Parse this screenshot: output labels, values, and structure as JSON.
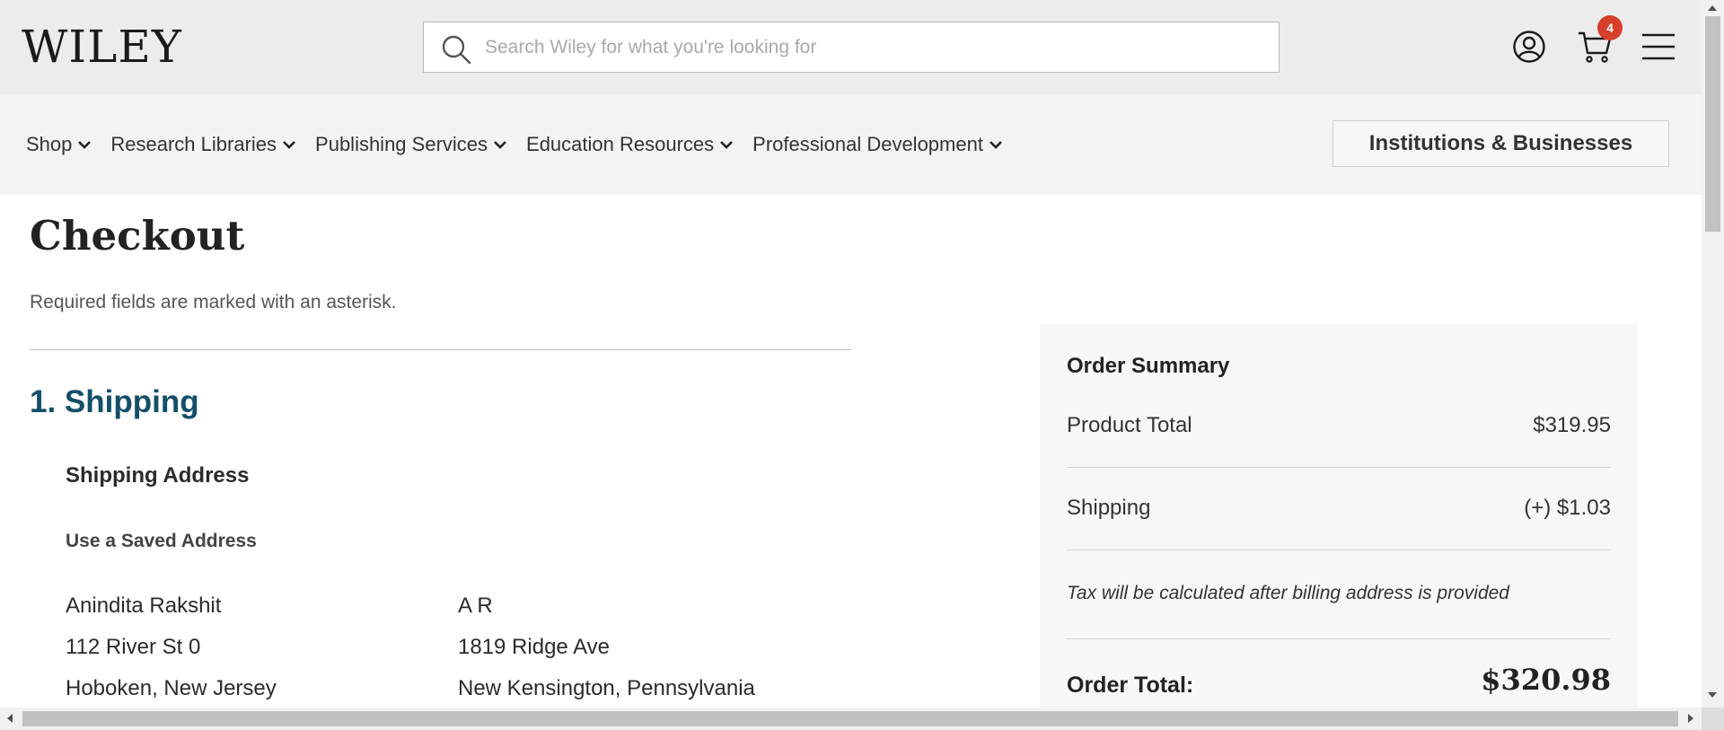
{
  "header": {
    "logo": "WILEY",
    "search_placeholder": "Search Wiley for what you're looking for",
    "cart_count": "4",
    "icons": [
      "search-icon",
      "account-icon",
      "cart-icon",
      "menu-icon"
    ]
  },
  "nav": {
    "items": [
      {
        "label": "Shop"
      },
      {
        "label": "Research Libraries"
      },
      {
        "label": "Publishing Services"
      },
      {
        "label": "Education Resources"
      },
      {
        "label": "Professional Development"
      }
    ],
    "institutions_button": "Institutions & Businesses"
  },
  "checkout": {
    "title": "Checkout",
    "required_note": "Required fields are marked with an asterisk.",
    "shipping_heading": "1. Shipping",
    "shipping_address_heading": "Shipping Address",
    "saved_address_link": "Use a Saved Address",
    "addresses": [
      {
        "name": "Anindita Rakshit",
        "street": "112 River St 0",
        "city": "Hoboken, New Jersey"
      },
      {
        "name": "A R",
        "street": "1819 Ridge Ave",
        "city": "New Kensington, Pennsylvania"
      }
    ]
  },
  "summary": {
    "title": "Order Summary",
    "product_total_label": "Product Total",
    "product_total_value": "$319.95",
    "shipping_label": "Shipping",
    "shipping_value": "(+) $1.03",
    "tax_note": "Tax will be calculated after billing address is provided",
    "order_total_label": "Order Total:",
    "order_total_value": "$320.98"
  },
  "colors": {
    "header_bg": "#ececec",
    "nav_bg": "#f3f3f3",
    "accent": "#134f69",
    "badge": "#d6402a",
    "summary_bg": "#f7f7f7"
  }
}
